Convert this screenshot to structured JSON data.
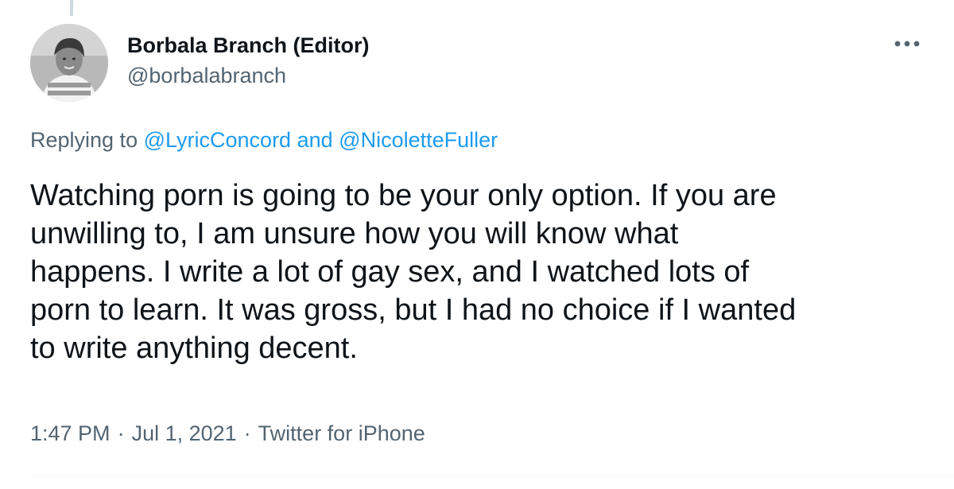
{
  "tweet": {
    "author": {
      "display_name": "Borbala Branch (Editor)",
      "handle": "@borbalabranch",
      "avatar_icon": "user-avatar-photo"
    },
    "reply_context": {
      "prefix": "Replying to",
      "mention_1": "@LyricConcord",
      "conjunction": "and",
      "mention_2": "@NicoletteFuller"
    },
    "text_lines": [
      "Watching porn is going to be your only option. If you are",
      "unwilling to, I am unsure how you will know what",
      "happens. I write a lot of gay sex, and I watched lots of",
      "porn to learn. It was gross, but I had no choice if I wanted",
      "to write anything decent."
    ],
    "time": "1:47 PM",
    "date": "Jul 1, 2021",
    "source": "Twitter for iPhone",
    "separator": "·",
    "more_icon": "more-horizontal-icon"
  },
  "colors": {
    "text_primary": "#0f1419",
    "text_secondary": "#536471",
    "link": "#1d9bf0",
    "divider": "#eff3f4"
  }
}
